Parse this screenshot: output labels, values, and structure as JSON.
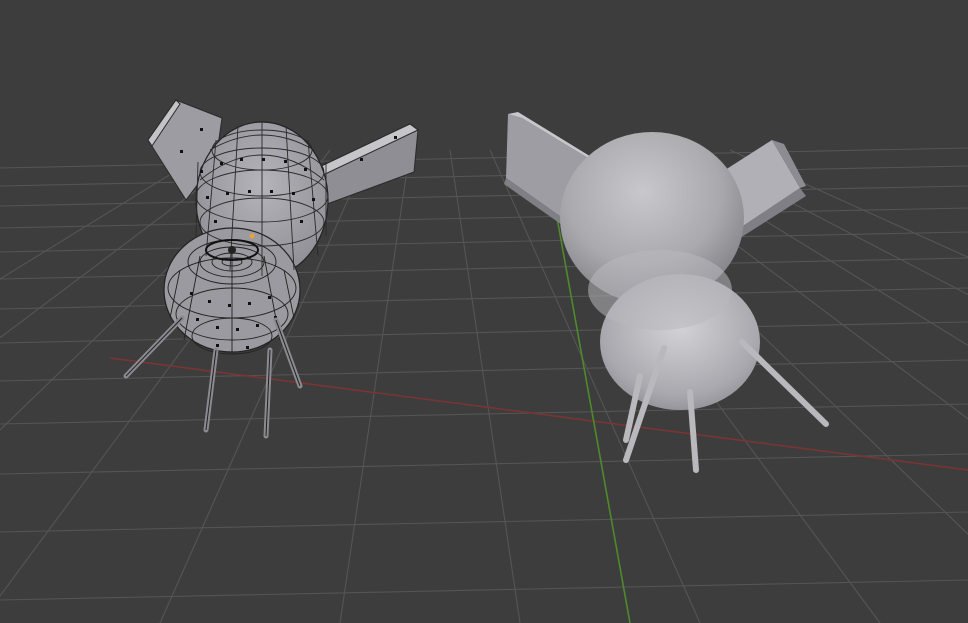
{
  "viewport": {
    "background": "#3d3d3d",
    "grid_color": "#5a5a5a",
    "x_axis_color": "#8a3a3a",
    "y_axis_color": "#4f8a2a"
  },
  "objects": [
    {
      "name": "rocket-mesh-edit-mode",
      "display": "wireframe-with-vertices"
    },
    {
      "name": "rocket-mesh-smooth",
      "display": "solid-shaded"
    }
  ]
}
